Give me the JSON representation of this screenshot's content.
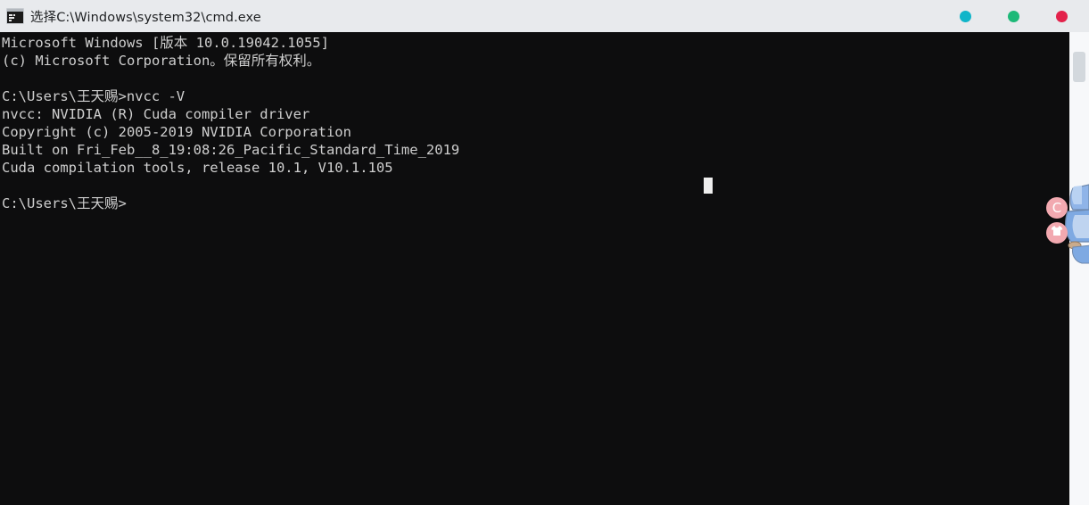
{
  "window": {
    "title": "选择C:\\Windows\\system32\\cmd.exe",
    "icon": "cmd-console-icon",
    "controls": [
      {
        "name": "minimize-dot",
        "color": "#10b5c9"
      },
      {
        "name": "maximize-dot",
        "color": "#1db978"
      },
      {
        "name": "close-dot",
        "color": "#e3224b"
      }
    ]
  },
  "terminal": {
    "background": "#0d0d0e",
    "foreground": "#cfcfcf",
    "lines": [
      "Microsoft Windows [版本 10.0.19042.1055]",
      "(c) Microsoft Corporation。保留所有权利。",
      "",
      "C:\\Users\\王天赐>nvcc -V",
      "nvcc: NVIDIA (R) Cuda compiler driver",
      "Copyright (c) 2005-2019 NVIDIA Corporation",
      "Built on Fri_Feb__8_19:08:26_Pacific_Standard_Time_2019",
      "Cuda compilation tools, release 10.1, V10.1.105",
      "",
      "C:\\Users\\王天赐>"
    ],
    "cursor": {
      "name": "text-cursor-block",
      "color": "#eeeeee"
    }
  },
  "scrollbar": {
    "name": "vertical-scrollbar",
    "thumb_color": "#d3d8dd",
    "track_color": "#f7f8fa"
  },
  "assistant": {
    "name": "floating-assistant-widget",
    "buttons": [
      {
        "name": "clipboard-c-button",
        "glyph": "C",
        "color": "#f2a9b0"
      },
      {
        "name": "tshirt-skin-button",
        "glyph": "👕",
        "color": "#f2a9b0"
      }
    ],
    "mascot": {
      "name": "blue-cat-mascot",
      "color": "#7fa8e0"
    }
  }
}
